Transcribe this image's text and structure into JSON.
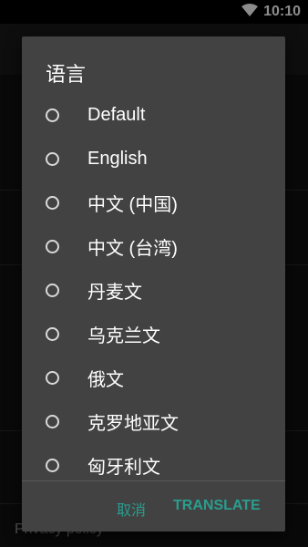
{
  "status": {
    "time": "10:10"
  },
  "background": {
    "privacy_label": "Privacy policy"
  },
  "dialog": {
    "title": "语言",
    "options": [
      {
        "label": "Default"
      },
      {
        "label": "English"
      },
      {
        "label": "中文 (中国)"
      },
      {
        "label": "中文 (台湾)"
      },
      {
        "label": "丹麦文"
      },
      {
        "label": "乌克兰文"
      },
      {
        "label": "俄文"
      },
      {
        "label": "克罗地亚文"
      },
      {
        "label": "匈牙利文"
      }
    ],
    "cancel_label": "取消",
    "translate_label": "TRANSLATE"
  }
}
